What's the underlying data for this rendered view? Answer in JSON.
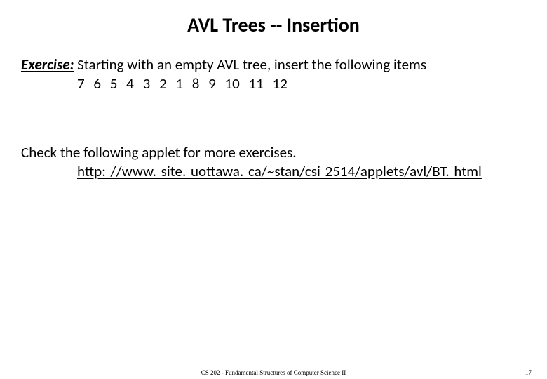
{
  "title": "AVL Trees -- Insertion",
  "exercise": {
    "label": "Exercise:",
    "prompt_rest": " Starting with an empty AVL tree, insert the following items",
    "items": "7   6   5   4   3   2   1   8   9   10   11   12"
  },
  "check_line": "Check the following applet for more exercises.",
  "link_text": "http: //www. site. uottawa. ca/~stan/csi 2514/applets/avl/BT. html",
  "footer": {
    "center": "CS 202 - Fundamental Structures of Computer Science II",
    "page": "17"
  }
}
